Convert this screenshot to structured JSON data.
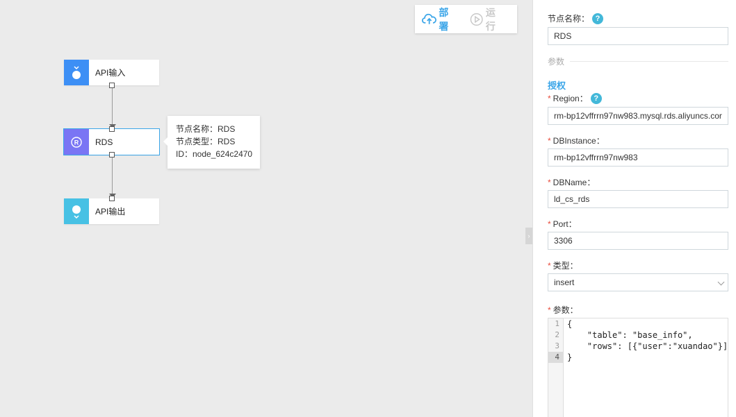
{
  "toolbar": {
    "deploy_label": "部署",
    "run_label": "运行",
    "deploy_color": "#3aa5e8",
    "run_color": "#c8c8c8"
  },
  "nodes": [
    {
      "label": "API输入",
      "icon": "api-input-icon",
      "color": "#3d8ff5"
    },
    {
      "label": "RDS",
      "icon": "rds-icon",
      "icon_letter": "R",
      "color": "#7a75f4"
    },
    {
      "label": "API输出",
      "icon": "api-output-icon",
      "color": "#47c1e4"
    }
  ],
  "tooltip": {
    "line1": "节点名称：RDS",
    "line2": "节点类型：RDS",
    "line3": "ID：node_624c2470"
  },
  "panel": {
    "node_name_label": "节点名称：",
    "node_name_value": "RDS",
    "params_section": "参数",
    "auth_title": "授权",
    "help_glyph": "?",
    "required_mark": "*",
    "region_label": "Region：",
    "region_value": "rm-bp12vffrrn97nw983.mysql.rds.aliyuncs.cor",
    "dbinstance_label": "DBInstance：",
    "dbinstance_value": "rm-bp12vffrrn97nw983",
    "dbname_label": "DBName：",
    "dbname_value": "ld_cs_rds",
    "port_label": "Port：",
    "port_value": "3306",
    "type_label": "类型：",
    "type_value": "insert",
    "params_label": "参数：",
    "code_lines": [
      {
        "num": "1",
        "text": "{"
      },
      {
        "num": "2",
        "text": "    \"table\": \"base_info\","
      },
      {
        "num": "3",
        "text": "    \"rows\": [{\"user\":\"xuandao\"}]"
      },
      {
        "num": "4",
        "text": "}"
      }
    ]
  },
  "accent_color": "#3aa5e8"
}
